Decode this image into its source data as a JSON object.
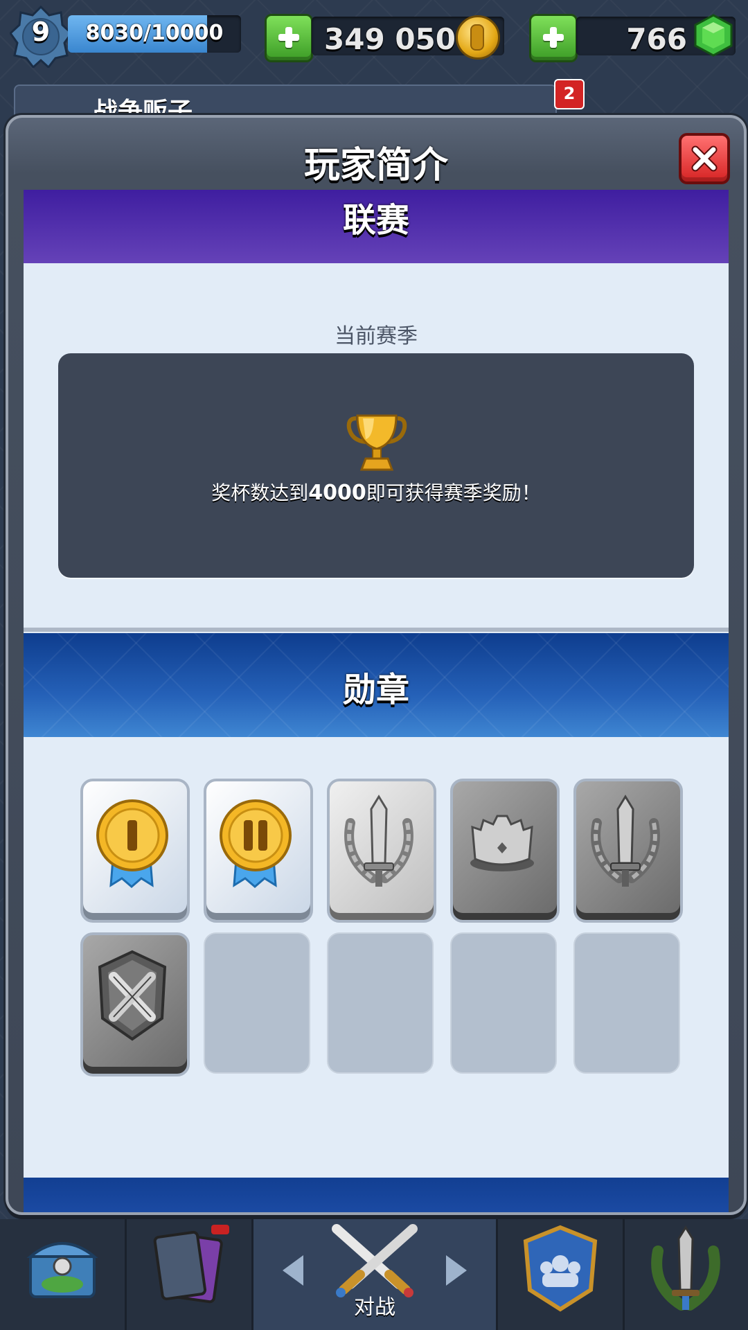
{
  "hud": {
    "level": "9",
    "xp_text": "8030/10000",
    "xp_progress": 0.803,
    "gold": "349 050",
    "gems": "766"
  },
  "clan": {
    "name": "战争贩子",
    "notification_count": "2"
  },
  "modal": {
    "title": "玩家简介",
    "league": {
      "title": "联赛",
      "season_label": "当前赛季",
      "message_prefix": "奖杯数达到",
      "trophy_target": "4000",
      "message_suffix": "即可获得赛季奖励！"
    },
    "badges": {
      "title": "勋章",
      "items": [
        {
          "icon": "gold-medal-1-icon",
          "style": "light"
        },
        {
          "icon": "gold-medal-2-icon",
          "style": "light"
        },
        {
          "icon": "sword-laurel-icon",
          "style": "silver"
        },
        {
          "icon": "crown-icon",
          "style": "dark"
        },
        {
          "icon": "sword-laurel-icon",
          "style": "dark"
        },
        {
          "icon": "crossed-swords-shield-icon",
          "style": "dark"
        },
        {
          "icon": "empty",
          "style": "empty"
        },
        {
          "icon": "empty",
          "style": "empty"
        },
        {
          "icon": "empty",
          "style": "empty"
        },
        {
          "icon": "empty",
          "style": "empty"
        }
      ]
    }
  },
  "bottom_nav": {
    "battle_label": "对战"
  },
  "colors": {
    "league_header": "#4a2aa8",
    "badges_header": "#1f56ad",
    "content_bg": "#e2ecf7",
    "panel_bg": "#3d4656",
    "close_red": "#e33333",
    "plus_green": "#52b830"
  }
}
